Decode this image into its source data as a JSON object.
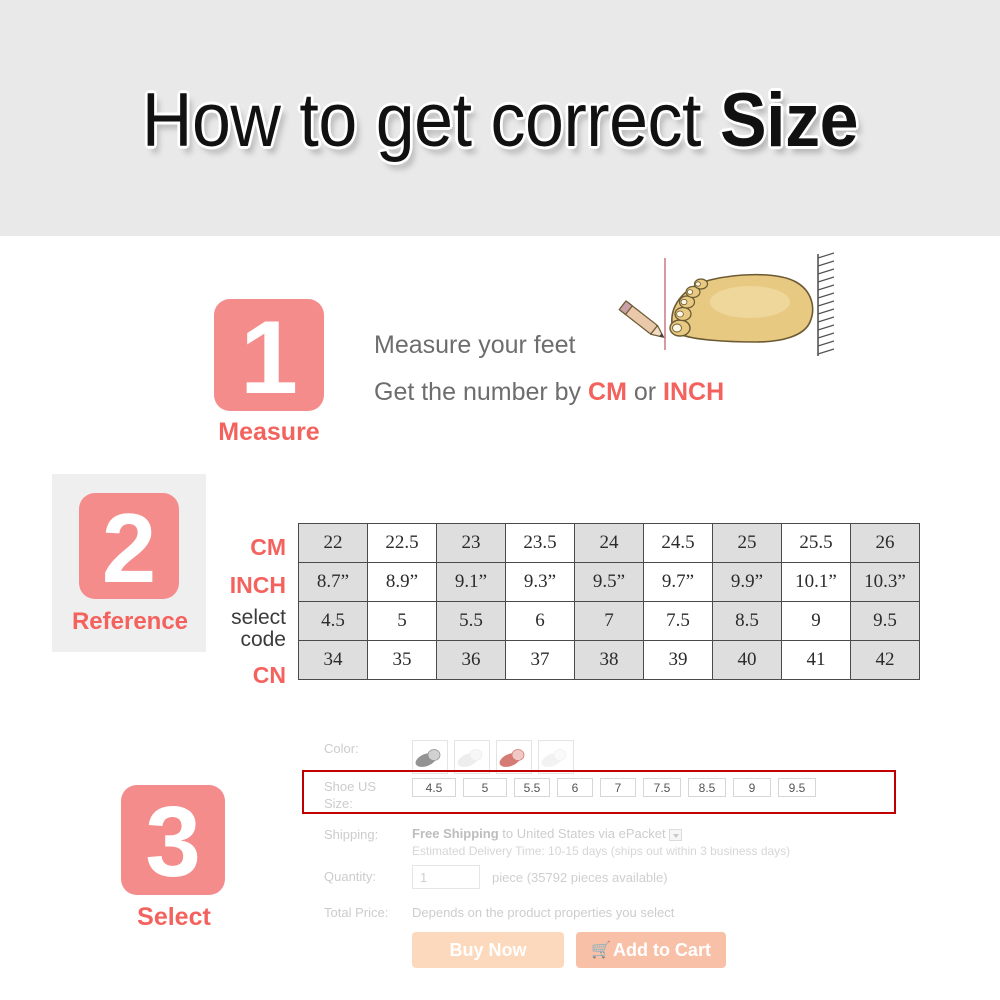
{
  "header": {
    "title_plain": "How to get correct ",
    "title_bold": "Size"
  },
  "colors": {
    "badge_pink": "#F58C8C",
    "accent_red": "#F4625E",
    "header_band": "#E9E9E9",
    "table_shade": "#DEDEDE",
    "highlight_border": "#C00000",
    "buy_now_bg": "#FCD9BD",
    "add_cart_bg": "#F9C0A8"
  },
  "steps": [
    {
      "number": "1",
      "label": "Measure"
    },
    {
      "number": "2",
      "label": "Reference"
    },
    {
      "number": "3",
      "label": "Select"
    }
  ],
  "step1": {
    "line1": "Measure your feet",
    "line2_prefix": "Get the number by ",
    "line2_unit1": "CM",
    "line2_middle": " or ",
    "line2_unit2": "INCH",
    "illustration": "foot-with-pencil-and-wall"
  },
  "size_table": {
    "row_labels": [
      "CM",
      "INCH",
      "select code",
      "CN"
    ],
    "select_code_line1": "select",
    "select_code_line2": "code",
    "rows": [
      {
        "label": "CM",
        "values": [
          "22",
          "22.5",
          "23",
          "23.5",
          "24",
          "24.5",
          "25",
          "25.5",
          "26"
        ]
      },
      {
        "label": "INCH",
        "values": [
          "8.7”",
          "8.9”",
          "9.1”",
          "9.3”",
          "9.5”",
          "9.7”",
          "9.9”",
          "10.1”",
          "10.3”"
        ]
      },
      {
        "label": "select code",
        "values": [
          "4.5",
          "5",
          "5.5",
          "6",
          "7",
          "7.5",
          "8.5",
          "9",
          "9.5"
        ]
      },
      {
        "label": "CN",
        "values": [
          "34",
          "35",
          "36",
          "37",
          "38",
          "39",
          "40",
          "41",
          "42"
        ]
      }
    ]
  },
  "product": {
    "color": {
      "label": "Color:",
      "swatches": [
        "shoe-swatch-gray",
        "shoe-swatch-white",
        "shoe-swatch-red",
        "shoe-swatch-pale"
      ]
    },
    "shoe_size": {
      "label_line1": "Shoe US",
      "label_line2": "Size:",
      "options": [
        "4.5",
        "5",
        "5.5",
        "6",
        "7",
        "7.5",
        "8.5",
        "9",
        "9.5"
      ]
    },
    "shipping": {
      "label": "Shipping:",
      "free_text": "Free Shipping",
      "destination": " to United States via ePacket",
      "estimate": "Estimated Delivery Time: 10-15 days (ships out within 3 business days)"
    },
    "quantity": {
      "label": "Quantity:",
      "value": "1",
      "note": "piece (35792 pieces available)"
    },
    "total_price": {
      "label": "Total Price:",
      "value": "Depends on the product properties you select"
    },
    "buttons": {
      "buy_now": "Buy Now",
      "add_to_cart": "Add to Cart",
      "cart_icon": "shopping-cart-icon"
    }
  }
}
